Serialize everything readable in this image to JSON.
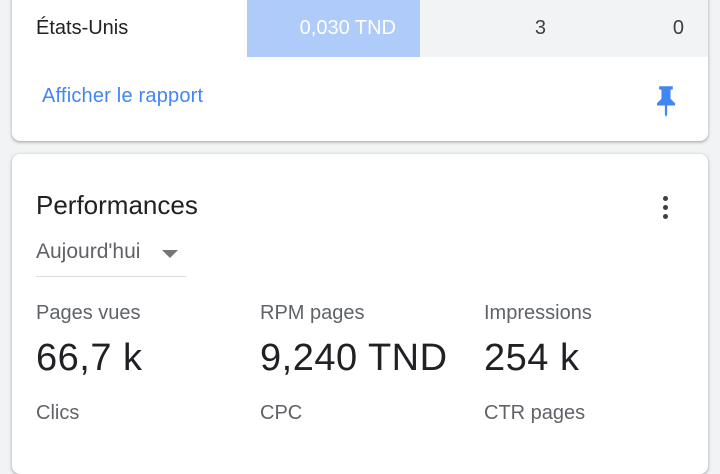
{
  "countries_table": {
    "row": {
      "country": "États-Unis",
      "revenue": "0,030 TND",
      "col2": "3",
      "col3": "0"
    },
    "view_report_label": "Afficher le rapport",
    "pin_icon": "pin-icon",
    "accent_color": "#4285f4",
    "highlight_color": "#aecbfa"
  },
  "performance": {
    "title": "Performances",
    "period": "Aujourd'hui",
    "menu_icon": "more-vert-icon",
    "metrics": [
      {
        "label": "Pages vues",
        "value": "66,7 k"
      },
      {
        "label": "RPM pages",
        "value": "9,240 TND"
      },
      {
        "label": "Impressions",
        "value": "254 k"
      },
      {
        "label": "Clics",
        "value": ""
      },
      {
        "label": "CPC",
        "value": ""
      },
      {
        "label": "CTR pages",
        "value": ""
      }
    ]
  }
}
